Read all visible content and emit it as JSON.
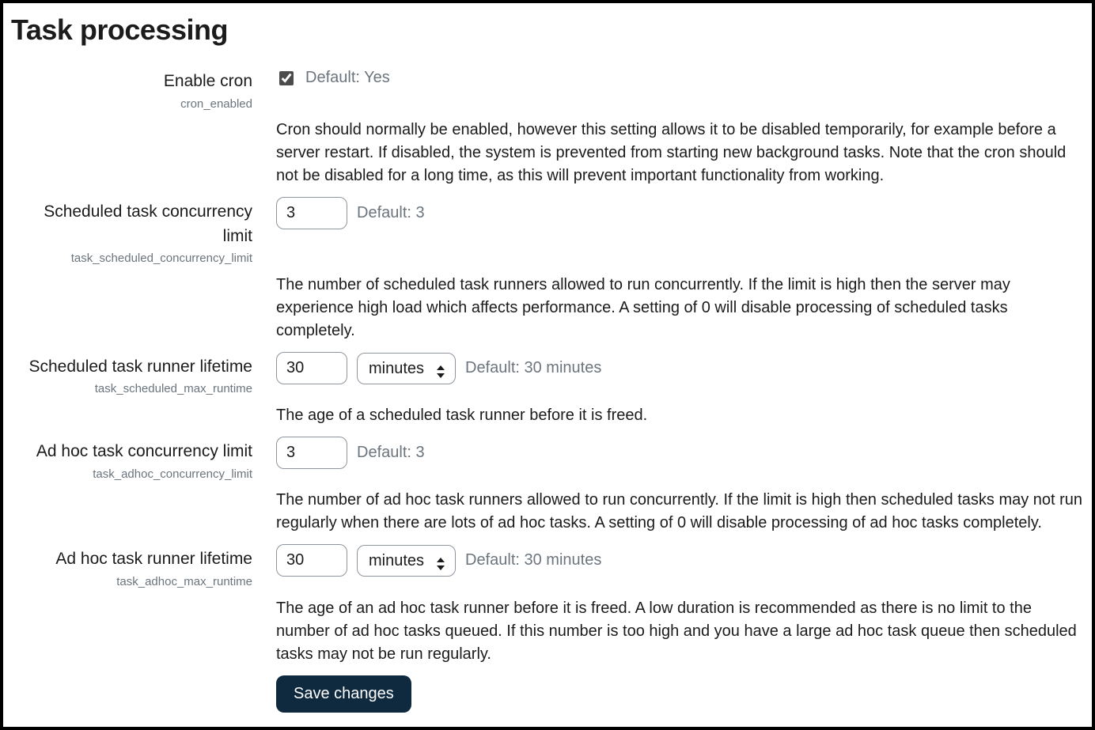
{
  "page": {
    "title": "Task processing"
  },
  "settings": {
    "cron": {
      "label": "Enable cron",
      "key": "cron_enabled",
      "checked": "checked",
      "default_text": "Default: Yes",
      "description": "Cron should normally be enabled, however this setting allows it to be disabled temporarily, for example before a server restart. If disabled, the system is prevented from starting new background tasks. Note that the cron should not be disabled for a long time, as this will prevent important functionality from working."
    },
    "sched_conc": {
      "label": "Scheduled task concurrency limit",
      "key": "task_scheduled_concurrency_limit",
      "value": "3",
      "default_text": "Default: 3",
      "description": "The number of scheduled task runners allowed to run concurrently. If the limit is high then the server may experience high load which affects performance. A setting of 0 will disable processing of scheduled tasks completely."
    },
    "sched_life": {
      "label": "Scheduled task runner lifetime",
      "key": "task_scheduled_max_runtime",
      "value": "30",
      "unit": "minutes",
      "default_text": "Default: 30 minutes",
      "description": "The age of a scheduled task runner before it is freed."
    },
    "adhoc_conc": {
      "label": "Ad hoc task concurrency limit",
      "key": "task_adhoc_concurrency_limit",
      "value": "3",
      "default_text": "Default: 3",
      "description": "The number of ad hoc task runners allowed to run concurrently. If the limit is high then scheduled tasks may not run regularly when there are lots of ad hoc tasks. A setting of 0 will disable processing of ad hoc tasks completely."
    },
    "adhoc_life": {
      "label": "Ad hoc task runner lifetime",
      "key": "task_adhoc_max_runtime",
      "value": "30",
      "unit": "minutes",
      "default_text": "Default: 30 minutes",
      "description": "The age of an ad hoc task runner before it is freed. A low duration is recommended as there is no limit to the number of ad hoc tasks queued. If this number is too high and you have a large ad hoc task queue then scheduled tasks may not be run regularly."
    }
  },
  "actions": {
    "save_label": "Save changes"
  }
}
